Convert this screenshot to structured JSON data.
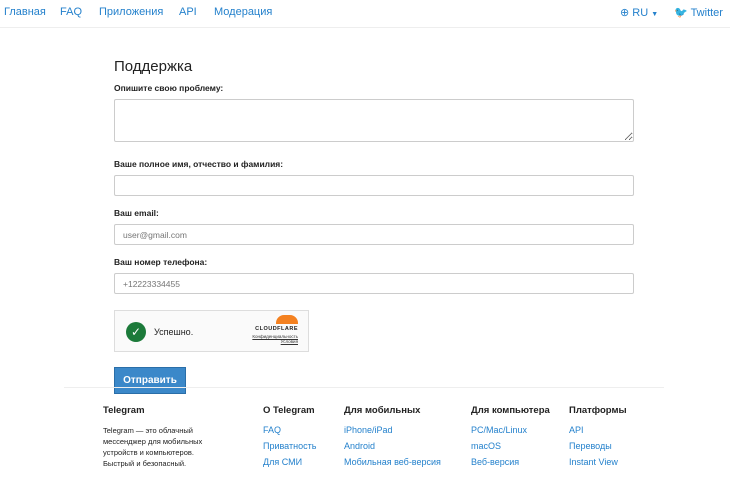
{
  "nav": {
    "items": [
      "Главная",
      "FAQ",
      "Приложения",
      "API",
      "Модерация"
    ],
    "lang": "RU",
    "twitter": "Twitter"
  },
  "form": {
    "title": "Поддержка",
    "problem_label": "Опишите свою проблему:",
    "problem_value": "",
    "name_label": "Ваше полное имя, отчество и фамилия:",
    "name_value": "",
    "email_label": "Ваш email:",
    "email_placeholder": "user@gmail.com",
    "phone_label": "Ваш номер телефона:",
    "phone_placeholder": "+12223334455",
    "captcha": {
      "status": "Успешно.",
      "brand": "CLOUDFLARE",
      "privacy": "Конфиденциальность",
      "terms": "Условия"
    },
    "submit": "Отправить"
  },
  "footer": {
    "about": {
      "title": "Telegram",
      "text": "Telegram — это облачный мессенджер для мобильных устройств и компьютеров. Быстрый и безопасный."
    },
    "columns": [
      {
        "title": "О Telegram",
        "links": [
          "FAQ",
          "Приватность",
          "Для СМИ"
        ]
      },
      {
        "title": "Для мобильных",
        "links": [
          "iPhone/iPad",
          "Android",
          "Мобильная веб-версия"
        ]
      },
      {
        "title": "Для компьютера",
        "links": [
          "PC/Mac/Linux",
          "macOS",
          "Веб-версия"
        ]
      },
      {
        "title": "Платформы",
        "links": [
          "API",
          "Переводы",
          "Instant View"
        ]
      }
    ]
  },
  "colors": {
    "link": "#2481cc",
    "button": "#3b88c9",
    "success": "#1c7a3a",
    "cloudflare": "#f48120"
  }
}
